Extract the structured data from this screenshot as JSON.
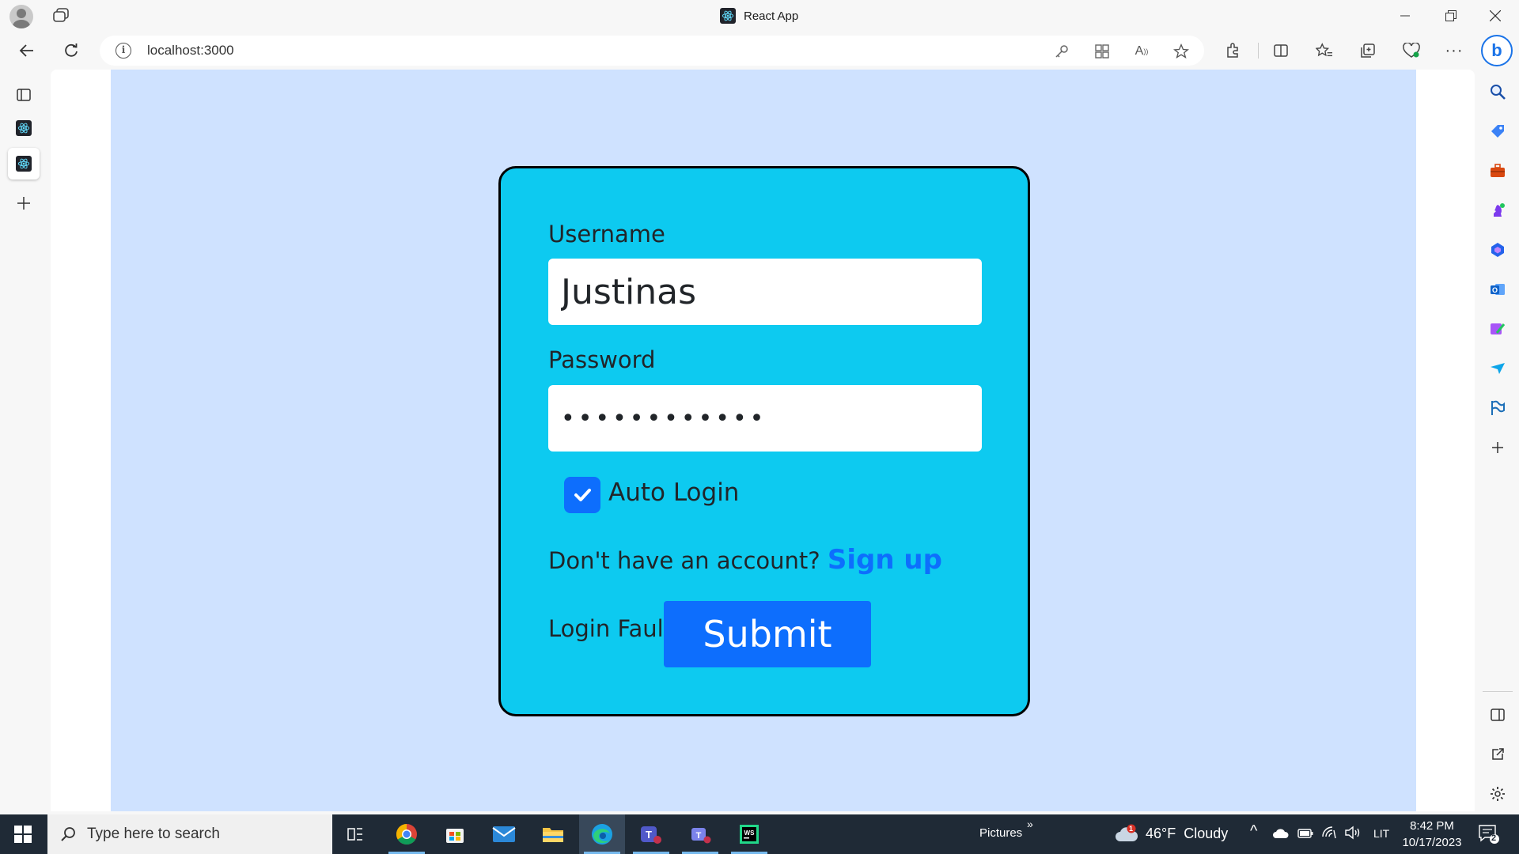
{
  "browser": {
    "window_title": "React App",
    "url": "localhost:3000"
  },
  "form": {
    "username_label": "Username",
    "username_value": "Justinas",
    "password_label": "Password",
    "password_value": "••••••••••••",
    "auto_login_label": "Auto Login",
    "auto_login_checked": true,
    "signup_prompt": "Don't have an account?",
    "signup_link": "Sign up",
    "login_fault": "Login Fault",
    "submit_label": "Submit"
  },
  "colors": {
    "page_background": "#cfe2ff",
    "card_background": "#0dcaf0",
    "primary": "#0d6efd"
  },
  "taskbar": {
    "search_placeholder": "Type here to search",
    "folder_label": "Pictures",
    "weather": "46°F  Cloudy",
    "weather_badge": "1",
    "language": "LIT",
    "time": "8:42 PM",
    "date": "10/17/2023",
    "notifications": "2"
  }
}
